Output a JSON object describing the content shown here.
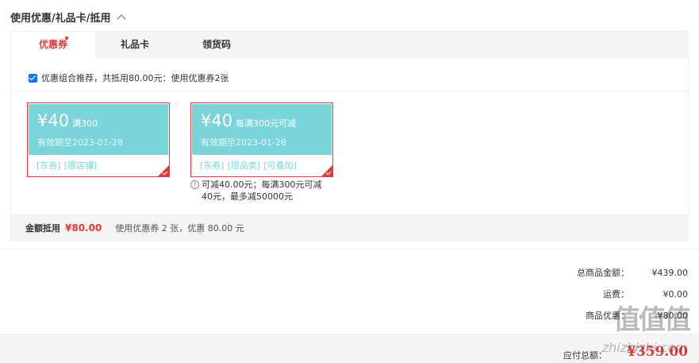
{
  "section": {
    "title": "使用优惠/礼品卡/抵用"
  },
  "tabs": [
    {
      "label": "优惠券",
      "active": true,
      "has_dot": true
    },
    {
      "label": "礼品卡",
      "active": false
    },
    {
      "label": "领货码",
      "active": false
    }
  ],
  "combo": {
    "checked": true,
    "text": "优惠组合推荐，共抵用80.00元：使用优惠券2张"
  },
  "coupons": [
    {
      "amount": "¥40",
      "condition": "满300",
      "valid": "有效期至2023-01-28",
      "tags": [
        "[东券]",
        "[限店铺]"
      ],
      "selected": true
    },
    {
      "amount": "¥40",
      "condition": "每满300元可减",
      "valid": "有效期至2023-01-28",
      "tags": [
        "[东券]",
        "[限品类]",
        "[可叠加]"
      ],
      "selected": true,
      "note": "可减40.00元；每满300元可减40元，最多减50000元"
    }
  ],
  "summary": {
    "label": "金额抵用",
    "amount": "¥80.00",
    "desc": "使用优惠券 2 张，优惠 80.00 元"
  },
  "totals": [
    {
      "label": "总商品金额：",
      "value": "¥439.00"
    },
    {
      "label": "运费：",
      "value": "¥0.00"
    },
    {
      "label": "商品优惠：",
      "value": "-¥80.00"
    }
  ],
  "footer": {
    "pay_label": "应付总额：",
    "pay_value": "¥359.00"
  },
  "watermark": {
    "main": "值值值",
    "sub": "zhizhizhi.com"
  },
  "colors": {
    "accent": "#e4393c",
    "coupon_bg": "#7bd4d9",
    "checkbox": "#1a73e8"
  }
}
